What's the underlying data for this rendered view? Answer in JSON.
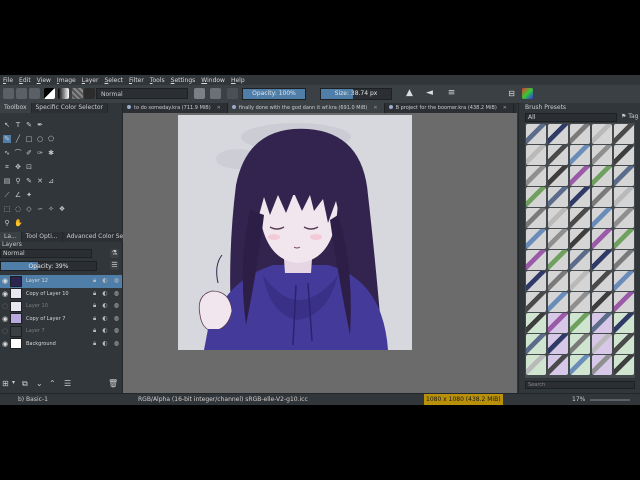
{
  "menu": [
    "File",
    "Edit",
    "View",
    "Image",
    "Layer",
    "Select",
    "Filter",
    "Tools",
    "Settings",
    "Window",
    "Help"
  ],
  "toolbar": {
    "blend_mode": "Normal",
    "opacity_label": "Opacity: 100%",
    "opacity_fraction": 1.0,
    "size_label": "Size: 38.74 px",
    "size_fraction": 0.45
  },
  "left_dock": {
    "top_tabs": [
      "Toolbox",
      "Specific Color Selector"
    ],
    "mid_tabs": [
      "La...",
      "Tool Opti...",
      "Advanced Color Sele..."
    ],
    "layers_title": "Layers",
    "layer_blend": "Normal",
    "layer_opacity_label": "Opacity: 39%",
    "layer_opacity_fraction": 0.39,
    "layers": [
      {
        "name": "Layer 12",
        "selected": true,
        "visible": true
      },
      {
        "name": "Copy of Layer 10",
        "selected": false,
        "visible": true
      },
      {
        "name": "Layer 10",
        "selected": false,
        "visible": false
      },
      {
        "name": "Copy of Layer 7",
        "selected": false,
        "visible": true
      },
      {
        "name": "Layer 7",
        "selected": false,
        "visible": false
      },
      {
        "name": "Background",
        "selected": false,
        "visible": true
      }
    ]
  },
  "documents": [
    {
      "title": "to do someday.kra (711.9 MiB)",
      "active": false
    },
    {
      "title": "finally done with the god dann it wf.kra (691.0 MiB)",
      "active": true
    },
    {
      "title": "B project for the boomer.kra (438.2 MiB)",
      "active": false
    }
  ],
  "brush_presets": {
    "title": "Brush Presets",
    "filter": "All",
    "tag_label": "Tag",
    "search_placeholder": "Search"
  },
  "status": {
    "brush": "b) Basic-1",
    "color_space": "RGB/Alpha (16-bit integer/channel)  sRGB-elle-V2-g10.icc",
    "dimensions": "1080 x 1080 (438.2 MiB)",
    "zoom": "17%"
  },
  "colors": {
    "accent": "#4f7ea8",
    "panel": "#31363b",
    "canvas_bg": "#6b6b6b",
    "art_bg": "#d7d8dd",
    "hair": "#33234f",
    "hoodie": "#443a9a",
    "skin": "#f2e6ee"
  }
}
